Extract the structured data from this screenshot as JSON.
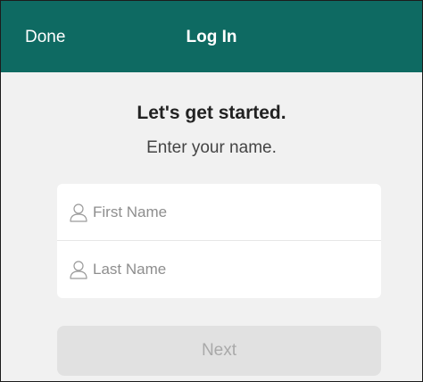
{
  "nav": {
    "done_label": "Done",
    "title": "Log In",
    "background_color": "#0e6a62"
  },
  "intro": {
    "heading": "Let's get started.",
    "subheading": "Enter your name."
  },
  "form": {
    "first_name": {
      "placeholder": "First Name",
      "value": "",
      "icon": "person-icon"
    },
    "last_name": {
      "placeholder": "Last Name",
      "value": "",
      "icon": "person-icon"
    }
  },
  "next_button": {
    "label": "Next",
    "state": "disabled"
  }
}
